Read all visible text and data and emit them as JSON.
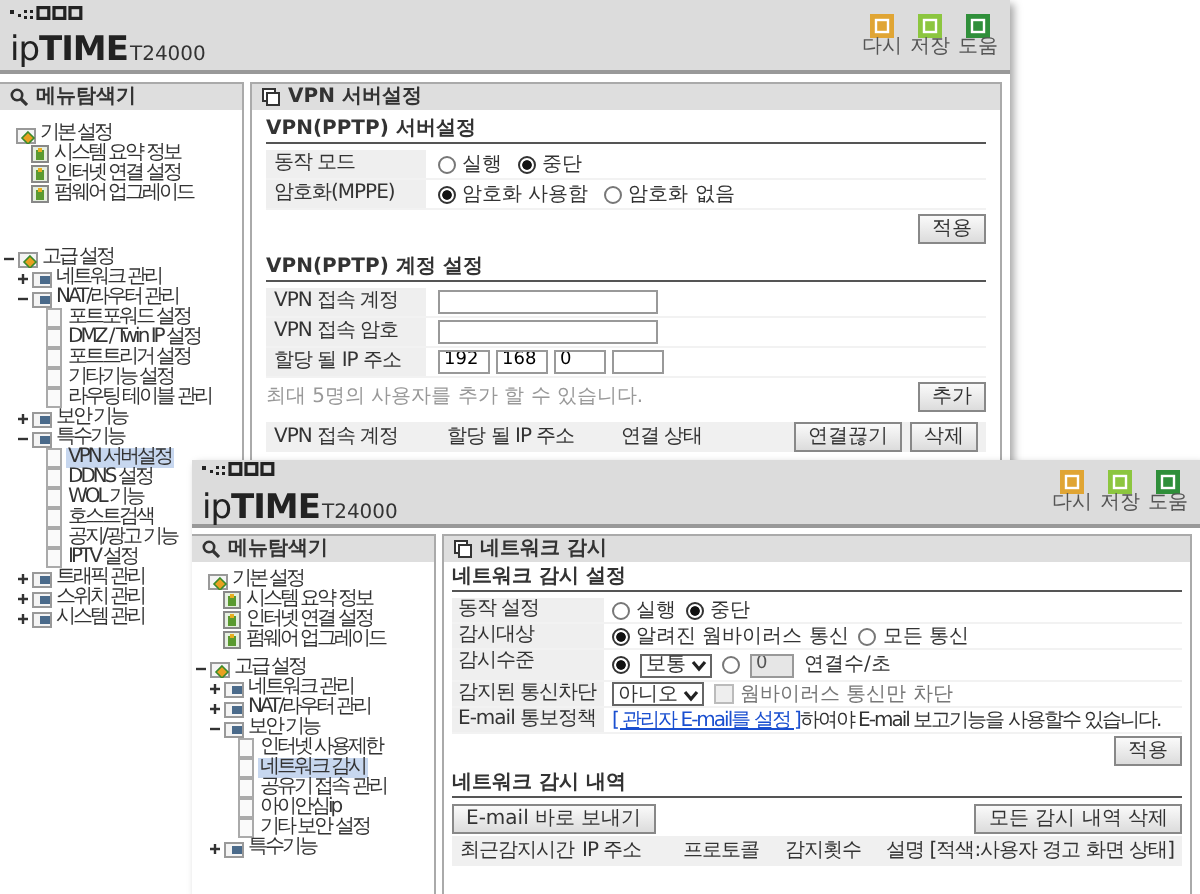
{
  "windows": [
    {
      "logo": {
        "brand": "ip**TIME**",
        "model": "T24000"
      },
      "toolbar": [
        {
          "label": "다시",
          "color": "#e0a534"
        },
        {
          "label": "저장",
          "color": "#8cc63f"
        },
        {
          "label": "도움",
          "color": "#2f8f3a"
        }
      ],
      "sidebar": {
        "title": "메뉴탐색기",
        "tree": [
          {
            "label": "기본 설정",
            "kind": "group",
            "children": [
              {
                "label": "시스템 요약 정보",
                "kind": "item",
                "selected": false
              },
              {
                "label": "인터넷 연결 설정",
                "kind": "item",
                "selected": false
              },
              {
                "label": "펌웨어 업그레이드",
                "kind": "item",
                "selected": false
              }
            ]
          },
          {
            "label": "고급 설정",
            "kind": "group",
            "expanded": true,
            "children": [
              {
                "label": "네트워크 관리",
                "kind": "folder",
                "expanded": false
              },
              {
                "label": "NAT/라우터 관리",
                "kind": "folder",
                "expanded": true,
                "children": [
                  {
                    "label": "포트포워드 설정",
                    "kind": "page",
                    "selected": false
                  },
                  {
                    "label": "DMZ / Twin IP 설정",
                    "kind": "page",
                    "selected": false
                  },
                  {
                    "label": "포트트리거 설정",
                    "kind": "page",
                    "selected": false
                  },
                  {
                    "label": "기타기능 설정",
                    "kind": "page",
                    "selected": false
                  },
                  {
                    "label": "라우팅 테이블 관리",
                    "kind": "page",
                    "selected": false
                  }
                ]
              },
              {
                "label": "보안 기능",
                "kind": "folder",
                "expanded": false
              },
              {
                "label": "특수기능",
                "kind": "folder",
                "expanded": true,
                "children": [
                  {
                    "label": "VPN 서버설정",
                    "kind": "page",
                    "selected": true
                  },
                  {
                    "label": "DDNS 설정",
                    "kind": "page",
                    "selected": false
                  },
                  {
                    "label": "WOL 기능",
                    "kind": "page",
                    "selected": false
                  },
                  {
                    "label": "호스트검색",
                    "kind": "page",
                    "selected": false
                  },
                  {
                    "label": "공지/광고 기능",
                    "kind": "page",
                    "selected": false
                  },
                  {
                    "label": "IPTV 설정",
                    "kind": "page",
                    "selected": false
                  }
                ]
              },
              {
                "label": "트래픽 관리",
                "kind": "folder",
                "expanded": false
              },
              {
                "label": "스위치 관리",
                "kind": "folder",
                "expanded": false
              },
              {
                "label": "시스템 관리",
                "kind": "folder",
                "expanded": false
              }
            ]
          }
        ]
      },
      "content": {
        "title": "VPN 서버설정",
        "sections": [
          {
            "heading": "VPN(PPTP) 서버설정",
            "rows": [
              {
                "label": "동작 모드",
                "controls": [
                  {
                    "kind": "radio",
                    "label": "실행",
                    "selected": false
                  },
                  {
                    "kind": "radio",
                    "label": "중단",
                    "selected": true
                  }
                ]
              },
              {
                "label": "암호화(MPPE)",
                "controls": [
                  {
                    "kind": "radio",
                    "label": "암호화 사용함",
                    "selected": true
                  },
                  {
                    "kind": "radio",
                    "label": "암호화 없음",
                    "selected": false
                  }
                ]
              }
            ],
            "actions": [
              "적용"
            ]
          },
          {
            "heading": "VPN(PPTP) 계정 설정",
            "rows": [
              {
                "label": "VPN 접속 계정",
                "controls": [
                  {
                    "kind": "input"
                  }
                ]
              },
              {
                "label": "VPN 접속 암호",
                "controls": [
                  {
                    "kind": "input"
                  }
                ]
              },
              {
                "label": "할당 될 IP 주소",
                "controls": [
                  {
                    "kind": "octet",
                    "value": "192"
                  },
                  {
                    "kind": "octet",
                    "value": "168"
                  },
                  {
                    "kind": "octet",
                    "value": "0"
                  },
                  {
                    "kind": "octet"
                  }
                ]
              }
            ],
            "note": "최대 5명의 사용자를 추가 할 수 있습니다.",
            "actions": [
              "추가"
            ],
            "table": {
              "columns": [
                "VPN 접속 계정",
                "할당 될 IP 주소",
                "연결 상태"
              ],
              "buttons": [
                "연결끊기",
                "삭제"
              ]
            }
          }
        ]
      }
    },
    {
      "logo": {
        "brand": "ip**TIME**",
        "model": "T24000"
      },
      "toolbar": [
        {
          "label": "다시",
          "color": "#e0a534"
        },
        {
          "label": "저장",
          "color": "#8cc63f"
        },
        {
          "label": "도움",
          "color": "#2f8f3a"
        }
      ],
      "sidebar": {
        "title": "메뉴탐색기",
        "tree": [
          {
            "label": "기본 설정",
            "kind": "group",
            "children": [
              {
                "label": "시스템 요약 정보",
                "kind": "item",
                "selected": false
              },
              {
                "label": "인터넷 연결 설정",
                "kind": "item",
                "selected": false
              },
              {
                "label": "펌웨어 업그레이드",
                "kind": "item",
                "selected": false
              }
            ]
          },
          {
            "label": "고급 설정",
            "kind": "group",
            "expanded": true,
            "children": [
              {
                "label": "네트워크 관리",
                "kind": "folder",
                "expanded": false
              },
              {
                "label": "NAT/라우터 관리",
                "kind": "folder",
                "expanded": false
              },
              {
                "label": "보안 기능",
                "kind": "folder",
                "expanded": true,
                "children": [
                  {
                    "label": "인터넷 사용제한",
                    "kind": "page",
                    "selected": false
                  },
                  {
                    "label": "네트워크 감시",
                    "kind": "page",
                    "selected": true
                  },
                  {
                    "label": "공유기 접속 관리",
                    "kind": "page",
                    "selected": false
                  },
                  {
                    "label": "아이안심ip",
                    "kind": "page",
                    "selected": false
                  },
                  {
                    "label": "기타 보안 설정",
                    "kind": "page",
                    "selected": false
                  }
                ]
              },
              {
                "label": "특수기능",
                "kind": "folder",
                "expanded": false
              }
            ]
          }
        ]
      },
      "content": {
        "title": "네트워크 감시",
        "sections": [
          {
            "heading": "네트워크 감시 설정",
            "rows": [
              {
                "label": "동작 설정",
                "controls": [
                  {
                    "kind": "radio",
                    "label": "실행",
                    "selected": false
                  },
                  {
                    "kind": "radio",
                    "label": "중단",
                    "selected": true
                  }
                ]
              },
              {
                "label": "감시대상",
                "controls": [
                  {
                    "kind": "radio",
                    "label": "알려진 웜바이러스 통신",
                    "selected": true
                  },
                  {
                    "kind": "radio",
                    "label": "모든 통신",
                    "selected": false
                  }
                ]
              },
              {
                "label": "감시수준",
                "controls": [
                  {
                    "kind": "radio",
                    "selected": true
                  },
                  {
                    "kind": "select",
                    "value": "보통"
                  },
                  {
                    "kind": "radio",
                    "selected": false
                  },
                  {
                    "kind": "input",
                    "value": "0",
                    "disabled": true
                  },
                  {
                    "kind": "text",
                    "text": "연결수/초"
                  }
                ]
              },
              {
                "label": "감지된 통신차단",
                "controls": [
                  {
                    "kind": "select",
                    "value": "아니오"
                  },
                  {
                    "kind": "checkbox",
                    "label": "웜바이러스 통신만 차단",
                    "checked": false,
                    "disabled": true
                  }
                ]
              },
              {
                "label": "E-mail 통보정책",
                "controls": [
                  {
                    "kind": "text",
                    "link": "[ 관리자 E-mail를 설정 ]",
                    "text": "하여야 E-mail 보고기능을 사용할수 있습니다."
                  }
                ]
              }
            ],
            "actions": [
              "적용"
            ]
          },
          {
            "heading": "네트워크 감시 내역",
            "toolbar": {
              "left": [
                "E-mail 바로 보내기"
              ],
              "right": [
                "모든 감시 내역 삭제"
              ]
            },
            "table": {
              "columns": [
                "최근감지시간",
                "IP 주소",
                "프로토콜",
                "감지횟수",
                "설명 [적색:사용자 경고 화면 상태]"
              ]
            }
          }
        ]
      }
    }
  ]
}
